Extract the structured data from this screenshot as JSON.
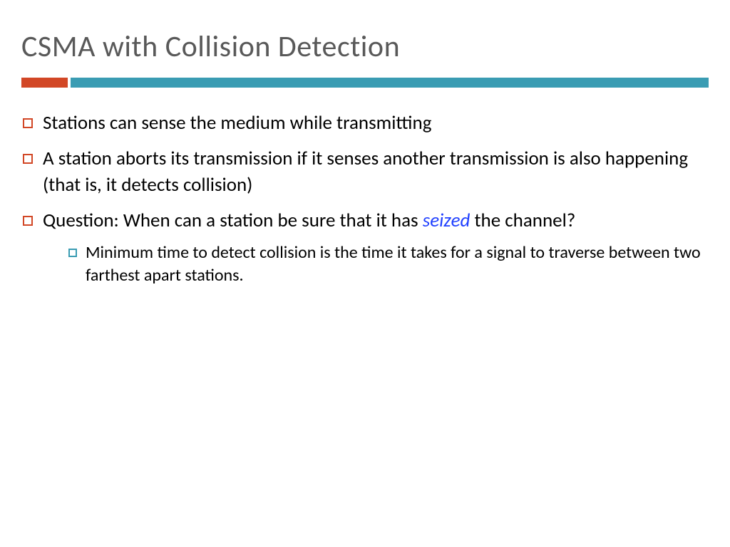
{
  "title": "CSMA with Collision Detection",
  "bullets": [
    {
      "text": "Stations can sense the medium while transmitting"
    },
    {
      "text": "A station aborts its transmission if it senses another transmission is also happening (that is, it detects collision)"
    },
    {
      "prefix": "Question: When can a station be sure that it has ",
      "highlight": "seized",
      "suffix": " the channel?",
      "sub": "Minimum time to detect collision is the time it takes for a signal to traverse between two farthest apart stations."
    }
  ],
  "colors": {
    "title": "#595959",
    "accentRed": "#d24726",
    "accentTeal": "#3a9cb3",
    "highlight": "#2040ff"
  }
}
